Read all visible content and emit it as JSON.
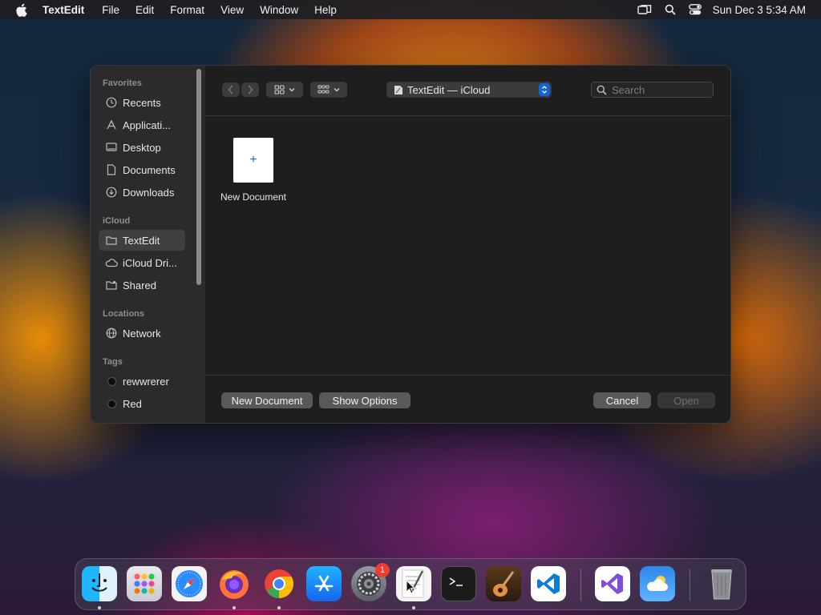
{
  "menubar": {
    "app_name": "TextEdit",
    "menus": [
      "File",
      "Edit",
      "Format",
      "View",
      "Window",
      "Help"
    ],
    "clock": "Sun Dec 3  5:34 AM",
    "status_icons": [
      "screen-mirroring-icon",
      "spotlight-search-icon",
      "control-center-icon"
    ]
  },
  "sidebar": {
    "sections": [
      {
        "title": "Favorites",
        "items": [
          {
            "label": "Recents",
            "icon": "clock-icon"
          },
          {
            "label": "Applicati...",
            "icon": "applications-icon"
          },
          {
            "label": "Desktop",
            "icon": "desktop-icon"
          },
          {
            "label": "Documents",
            "icon": "document-icon"
          },
          {
            "label": "Downloads",
            "icon": "download-icon"
          }
        ]
      },
      {
        "title": "iCloud",
        "items": [
          {
            "label": "TextEdit",
            "icon": "folder-icon",
            "selected": true
          },
          {
            "label": "iCloud Dri...",
            "icon": "cloud-icon"
          },
          {
            "label": "Shared",
            "icon": "shared-folder-icon"
          }
        ]
      },
      {
        "title": "Locations",
        "items": [
          {
            "label": "Network",
            "icon": "globe-icon"
          }
        ]
      },
      {
        "title": "Tags",
        "items": [
          {
            "label": "rewwrerer",
            "icon": "tag-dot-icon"
          },
          {
            "label": "Red",
            "icon": "tag-dot-icon"
          }
        ]
      }
    ]
  },
  "toolbar": {
    "location": "TextEdit — iCloud",
    "search_placeholder": "Search"
  },
  "content": {
    "new_document_tile_label": "New Document",
    "new_document_tile_symbol": "+"
  },
  "footer": {
    "new_document": "New Document",
    "show_options": "Show Options",
    "cancel": "Cancel",
    "open": "Open"
  },
  "dock": {
    "apps": [
      "Finder",
      "Launchpad",
      "Safari",
      "Firefox",
      "Chrome",
      "App Store",
      "System Settings",
      "TextEdit",
      "Terminal",
      "GarageBand",
      "Visual Studio Code",
      "Visual Studio",
      "Weather",
      "Trash"
    ],
    "settings_badge": "1"
  }
}
